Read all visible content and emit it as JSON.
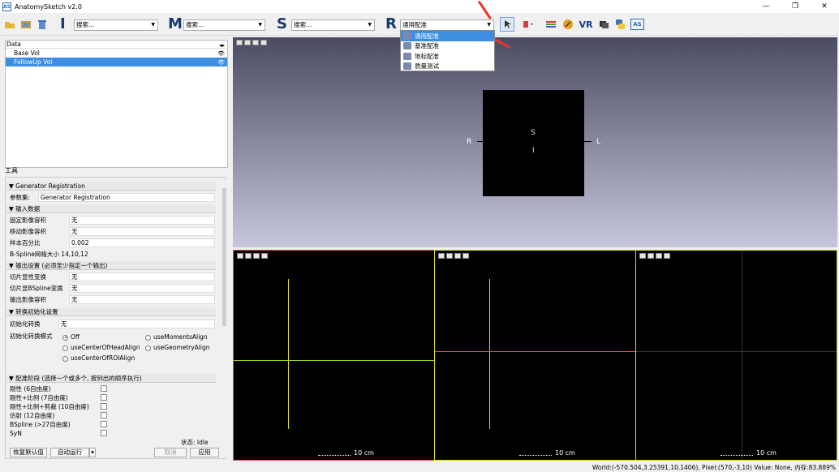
{
  "window": {
    "icon": "AS",
    "title": "AnatomySketch v2.0",
    "minimize": "—",
    "maximize": "❐",
    "close": "✕"
  },
  "toolbar": {
    "combo_i": "搜索...",
    "combo_m": "搜索...",
    "combo_s": "搜索...",
    "combo_r": "通用配准",
    "letters": {
      "i": "I",
      "m": "M",
      "s": "S",
      "r": "R"
    },
    "vr": "VR",
    "as_btn": "AS"
  },
  "dropdown": {
    "items": [
      "通用配准",
      "通用配准",
      "基准配准",
      "地标配准",
      "质量测试"
    ]
  },
  "data_panel": {
    "header": "Data",
    "items": [
      "Base Vol",
      "FollowUp Vol"
    ]
  },
  "tools": {
    "label": "工具",
    "gen_reg": "Generator Registration",
    "param_label": "参数集:",
    "param_value": "Generator Registration",
    "input_sect": "输入数据",
    "fixed_label": "固定影像容积",
    "fixed_val": "无",
    "moving_label": "移动影像容积",
    "moving_val": "无",
    "sample_label": "样本百分比",
    "sample_val": "0.002",
    "bspline_label": "B-Spline网格大小 14,10,12",
    "out_sect": "输出设置 (必须至少指定一个输出)",
    "out1_label": "切片显性变换",
    "out1_val": "无",
    "out2_label": "切片显BSpline变换",
    "out2_val": "无",
    "out3_label": "输出影像容积",
    "out3_val": "无",
    "init_sect": "转换初始化设置",
    "init_label": "初始化转换",
    "init_val": "无",
    "mode_label": "初始化转换模式",
    "modes": [
      "Off",
      "useMomentsAlign",
      "useCenterOfHeadAlign",
      "useGeometryAlign",
      "useCenterOfROIAlign"
    ],
    "reg_sect": "配准阶段 (选择一个或多个, 按列出的顺序执行)",
    "stages": [
      "刚性 (6自由度)",
      "刚性+比例 (7自由度)",
      "刚性+比例+剪裁 (10自由度)",
      "仿射 (12自由度)",
      "BSpline (>27自由度)",
      "SyN"
    ],
    "state": "状态: Idle",
    "btn_reset": "恢复默认值",
    "btn_auto": "自动运行",
    "btn_cancel": "取消",
    "btn_apply": "应用"
  },
  "view3d": {
    "top": "S",
    "inner": "I",
    "left": "R",
    "right": "L"
  },
  "slices": [
    {
      "border": "#e05050",
      "scale": "10 cm"
    },
    {
      "border": "#d8d830",
      "scale": "10 cm"
    },
    {
      "border": "#d8d830",
      "scale": "10 cm"
    }
  ],
  "status": "World:(-570.504,3.25391,10.1406), Pixel:(570,-3,10) Value: None, 内存:83.889%"
}
